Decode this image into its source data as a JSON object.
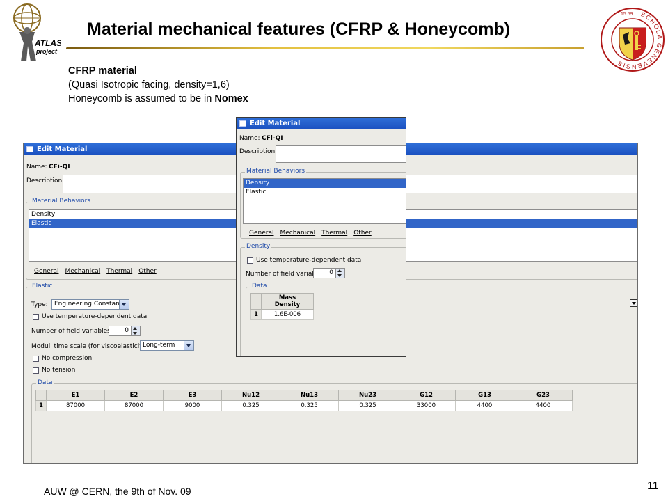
{
  "slide": {
    "title": "Material mechanical features (CFRP & Honeycomb)",
    "intro_line1": "CFRP material",
    "intro_line2": "(Quasi Isotropic facing, density=1,6)",
    "intro_line3_prefix": "Honeycomb is assumed to be in ",
    "intro_line3_bold": "Nomex",
    "footer": "AUW @ CERN, the 9th of Nov. 09",
    "page_number": "11"
  },
  "logos": {
    "atlas_line1": "ATLAS",
    "atlas_line2": "project",
    "unige_ring_text": "SCHOLA GENEVENSIS",
    "unige_year": "15 59"
  },
  "elastic_window": {
    "title": "Edit Material",
    "name_label": "Name:",
    "name_value": "CFi-QI",
    "description_label": "Description:",
    "behaviors_group": "Material Behaviors",
    "behaviors": [
      "Density",
      "Elastic"
    ],
    "selected_behavior": "Elastic",
    "menu": [
      "General",
      "Mechanical",
      "Thermal",
      "Other"
    ],
    "section": "Elastic",
    "type_label": "Type:",
    "type_value": "Engineering Constants",
    "temp_dependent_label": "Use temperature-dependent data",
    "field_vars_label": "Number of field variables:",
    "field_vars_value": "0",
    "moduli_label": "Moduli time scale (for viscoelasticity):",
    "moduli_value": "Long-term",
    "no_compression_label": "No compression",
    "no_tension_label": "No tension",
    "data_group": "Data",
    "table_columns": [
      "E1",
      "E2",
      "E3",
      "Nu12",
      "Nu13",
      "Nu23",
      "G12",
      "G13",
      "G23"
    ],
    "table_rows": [
      {
        "index": "1",
        "values": [
          "87000",
          "87000",
          "9000",
          "0.325",
          "0.325",
          "0.325",
          "33000",
          "4400",
          "4400"
        ]
      }
    ]
  },
  "density_window": {
    "title": "Edit Material",
    "name_label": "Name:",
    "name_value": "CFi-QI",
    "description_label": "Description:",
    "behaviors_group": "Material Behaviors",
    "behaviors": [
      "Density",
      "Elastic"
    ],
    "selected_behavior": "Density",
    "menu": [
      "General",
      "Mechanical",
      "Thermal",
      "Other"
    ],
    "section": "Density",
    "temp_dependent_label": "Use temperature-dependent data",
    "field_vars_label": "Number of field variables:",
    "field_vars_value": "0",
    "data_group": "Data",
    "table_header_line1": "Mass",
    "table_header_line2": "Density",
    "table_rows": [
      {
        "index": "1",
        "value": "1.6E-006"
      }
    ]
  },
  "colors": {
    "titlebar": "#1f5bd0",
    "selection": "#3165c8",
    "group_title": "#1f4aa8",
    "window_bg": "#ecebe6"
  }
}
